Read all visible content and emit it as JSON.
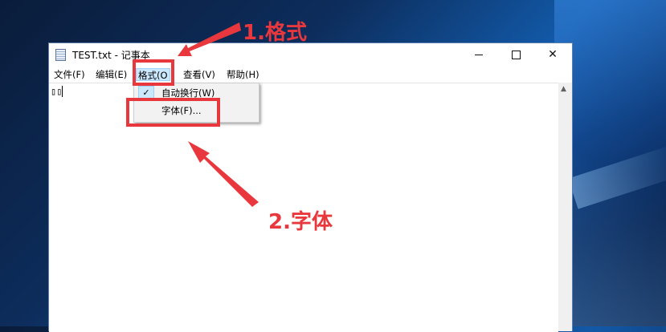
{
  "window": {
    "title": "TEST.txt - 记事本",
    "controls": {
      "minimize": "minimize-icon",
      "maximize": "maximize-icon",
      "close": "✕"
    }
  },
  "menubar": {
    "items": [
      {
        "label": "文件(F)"
      },
      {
        "label": "编辑(E)"
      },
      {
        "label": "格式(O"
      },
      {
        "label": "查看(V)"
      },
      {
        "label": "帮助(H)"
      }
    ]
  },
  "editor": {
    "content": "▯▯"
  },
  "format_menu": {
    "items": [
      {
        "label": "自动换行(W)",
        "checked": true,
        "check_glyph": "✓"
      },
      {
        "label": "字体(F)..."
      }
    ]
  },
  "annotations": {
    "step1": "1.格式",
    "step2": "2.字体",
    "color": "#e8383d"
  }
}
